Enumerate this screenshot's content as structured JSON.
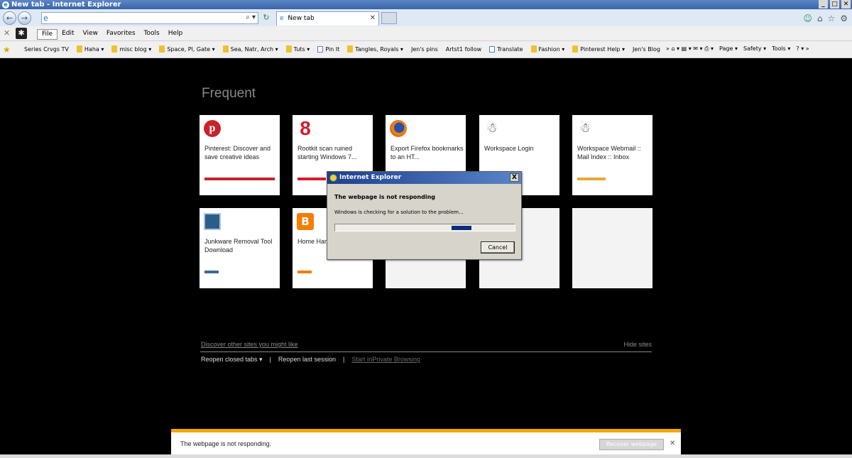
{
  "window": {
    "title": "New tab - Internet Explorer",
    "minimize_label": "_",
    "maximize_label": "□",
    "close_label": "✕"
  },
  "address_bar": {
    "url": "",
    "search_glyph": "⌕ ▾",
    "back_glyph": "←",
    "forward_glyph": "→"
  },
  "tabs": [
    {
      "label": "New tab",
      "close_glyph": "✕"
    }
  ],
  "menu": {
    "items": [
      "File",
      "Edit",
      "View",
      "Favorites",
      "Tools",
      "Help"
    ]
  },
  "favorites": [
    {
      "label": "Series Crvgs TV",
      "type": "none"
    },
    {
      "label": "Haha ▾",
      "type": "folder"
    },
    {
      "label": "misc blog ▾",
      "type": "folder"
    },
    {
      "label": "Space, Pl, Gate ▾",
      "type": "folder"
    },
    {
      "label": "Sea, Natr, Arch ▾",
      "type": "folder"
    },
    {
      "label": "Tuts ▾",
      "type": "folder"
    },
    {
      "label": "Pin It",
      "type": "page"
    },
    {
      "label": "Tangles, Royals ▾",
      "type": "folder"
    },
    {
      "label": "Jen's pins",
      "type": "none"
    },
    {
      "label": "Artst1 follow",
      "type": "none"
    },
    {
      "label": "Translate",
      "type": "page"
    },
    {
      "label": "Fashion ▾",
      "type": "folder"
    },
    {
      "label": "Pinterest Help ▾",
      "type": "folder"
    },
    {
      "label": "Jen's Blog",
      "type": "none"
    }
  ],
  "command_bar": [
    "» ⌂ ▾ ▤ ▾ ✉ ▾ ⎙ ▾",
    "Page ▾",
    "Safety ▾",
    "Tools ▾",
    "? ▾ »"
  ],
  "new_tab_page": {
    "heading": "Frequent",
    "tiles": [
      {
        "title": "Pinterest: Discover and save creative ideas",
        "icon": "pinterest-icon",
        "bar_color": "#c8232c",
        "bar_fill": 1.0
      },
      {
        "title": "Rootkit scan ruined starting Windows 7...",
        "icon": "rootkit-icon",
        "bar_color": "#d11d2c",
        "bar_fill": 0.4
      },
      {
        "title": "Export Firefox bookmarks to an HT...",
        "icon": "firefox-icon",
        "bar_color": "#e8861a",
        "bar_fill": 0.0
      },
      {
        "title": "Workspace Login",
        "icon": "workspace-icon",
        "bar_color": "#e8a838",
        "bar_fill": 0.4
      },
      {
        "title": "Workspace Webmail :: Mail Index :: Inbox",
        "icon": "workspace-icon",
        "bar_color": "#e8a838",
        "bar_fill": 0.4
      },
      {
        "title": "Junkware Removal Tool Download",
        "icon": "junkware-icon",
        "bar_color": "#3d6a96",
        "bar_fill": 0.2
      },
      {
        "title": "Home Har",
        "icon": "blogger-icon",
        "bar_color": "#f57d00",
        "bar_fill": 0.2
      },
      {
        "title": "",
        "icon": "",
        "bar_color": "",
        "bar_fill": 0
      },
      {
        "title": "",
        "icon": "",
        "bar_color": "",
        "bar_fill": 0
      },
      {
        "title": "",
        "icon": "",
        "bar_color": "",
        "bar_fill": 0
      }
    ],
    "discover_link": "Discover other sites you might like",
    "hide_sites": "Hide sites",
    "reopen_closed_tabs": "Reopen closed tabs ▾",
    "separator": "|",
    "reopen_last_session": "Reopen last session",
    "start_inprivate": "Start InPrivate Browsing"
  },
  "dialog": {
    "title": "Internet Explorer",
    "close_glyph": "X",
    "heading": "The webpage is not responding",
    "message": "Windows is checking for a solution to the problem...",
    "cancel_label": "Cancel"
  },
  "notification": {
    "message": "The webpage is not responding.",
    "recover_label": "Recover webpage",
    "close_glyph": "✕",
    "accent_color": "#f1a800"
  }
}
